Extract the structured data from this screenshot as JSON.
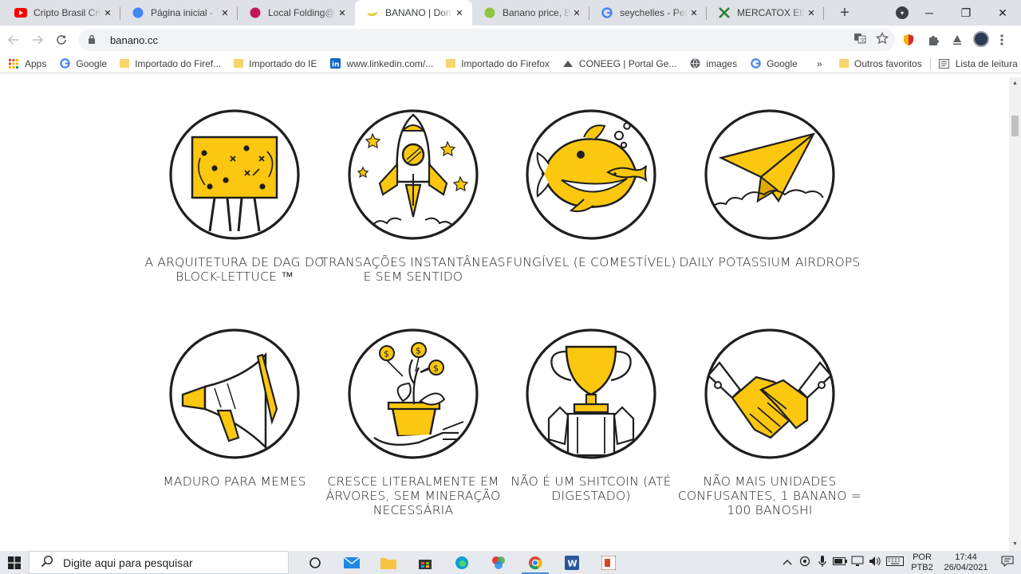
{
  "tabs": [
    {
      "title": "Cripto Brasil Cripto",
      "icon": "youtube-icon",
      "color": "#ff0000"
    },
    {
      "title": "Página inicial - Tr",
      "icon": "chrome-web-icon",
      "color": "#4285f4"
    },
    {
      "title": "Local Folding@ho",
      "icon": "folding-icon",
      "color": "#c2185b"
    },
    {
      "title": "BANANO | Don't",
      "icon": "banano-icon",
      "color": "#fbdd11",
      "active": true
    },
    {
      "title": "Banano price, BAN",
      "icon": "coingecko-icon",
      "color": "#8dc63f"
    },
    {
      "title": "seychelles - Pesqu",
      "icon": "google-icon",
      "color": "#4285f4"
    },
    {
      "title": "MERCATOX Ether",
      "icon": "mercatox-icon",
      "color": "#2e7d32"
    }
  ],
  "new_tab_symbol": "+",
  "window_controls": {
    "minimize": "─",
    "maximize": "❐",
    "close": "✕"
  },
  "address_bar": {
    "url": "banano.cc"
  },
  "bookmarks": [
    {
      "label": "Apps",
      "icon": "apps-grid-icon"
    },
    {
      "label": "Google",
      "icon": "google-icon"
    },
    {
      "label": "Importado do Firef...",
      "icon": "folder-icon"
    },
    {
      "label": "Importado do IE",
      "icon": "folder-icon"
    },
    {
      "label": "www.linkedin.com/...",
      "icon": "linkedin-icon"
    },
    {
      "label": "Importado do Firefox",
      "icon": "folder-icon"
    },
    {
      "label": "CONEEG | Portal Ge...",
      "icon": "coneeg-icon"
    },
    {
      "label": "images",
      "icon": "globe-icon"
    },
    {
      "label": "Google",
      "icon": "google-icon"
    }
  ],
  "bookmarks_overflow": "»",
  "bookmarks_right": [
    {
      "label": "Outros favoritos",
      "icon": "folder-icon"
    },
    {
      "label": "Lista de leitura",
      "icon": "reading-list-icon"
    }
  ],
  "features": [
    {
      "caption": "A ARQUITETURA DE DAG DO BLOCK-LETTUCE ™",
      "icon": "strategy-board-icon"
    },
    {
      "caption": "TRANSAÇÕES INSTANTÂNEAS E SEM SENTIDO",
      "icon": "rocket-icon"
    },
    {
      "caption": "FUNGÍVEL (E COMESTÍVEL)",
      "icon": "fish-icon"
    },
    {
      "caption": "DAILY POTASSIUM AIRDROPS",
      "icon": "paper-plane-icon"
    },
    {
      "caption": "MADURO PARA MEMES",
      "icon": "megaphone-icon"
    },
    {
      "caption": "CRESCE LITERALMENTE EM ÁRVORES, SEM MINERAÇÃO NECESSÁRIA",
      "icon": "money-tree-icon"
    },
    {
      "caption": "NÃO É UM SHITCOIN (ATÉ DIGESTADO)",
      "icon": "trophy-icon"
    },
    {
      "caption": "NÃO MAIS UNIDADES CONFUSANTES, 1 BANANO = 100 BANOSHI",
      "icon": "handshake-icon"
    }
  ],
  "colors": {
    "banana_yellow": "#fbc70f",
    "outline": "#1f1f1f"
  },
  "taskbar": {
    "search_placeholder": "Digite aqui para pesquisar",
    "language_top": "POR",
    "language_bottom": "PTB2",
    "time": "17:44",
    "date": "26/04/2021"
  }
}
